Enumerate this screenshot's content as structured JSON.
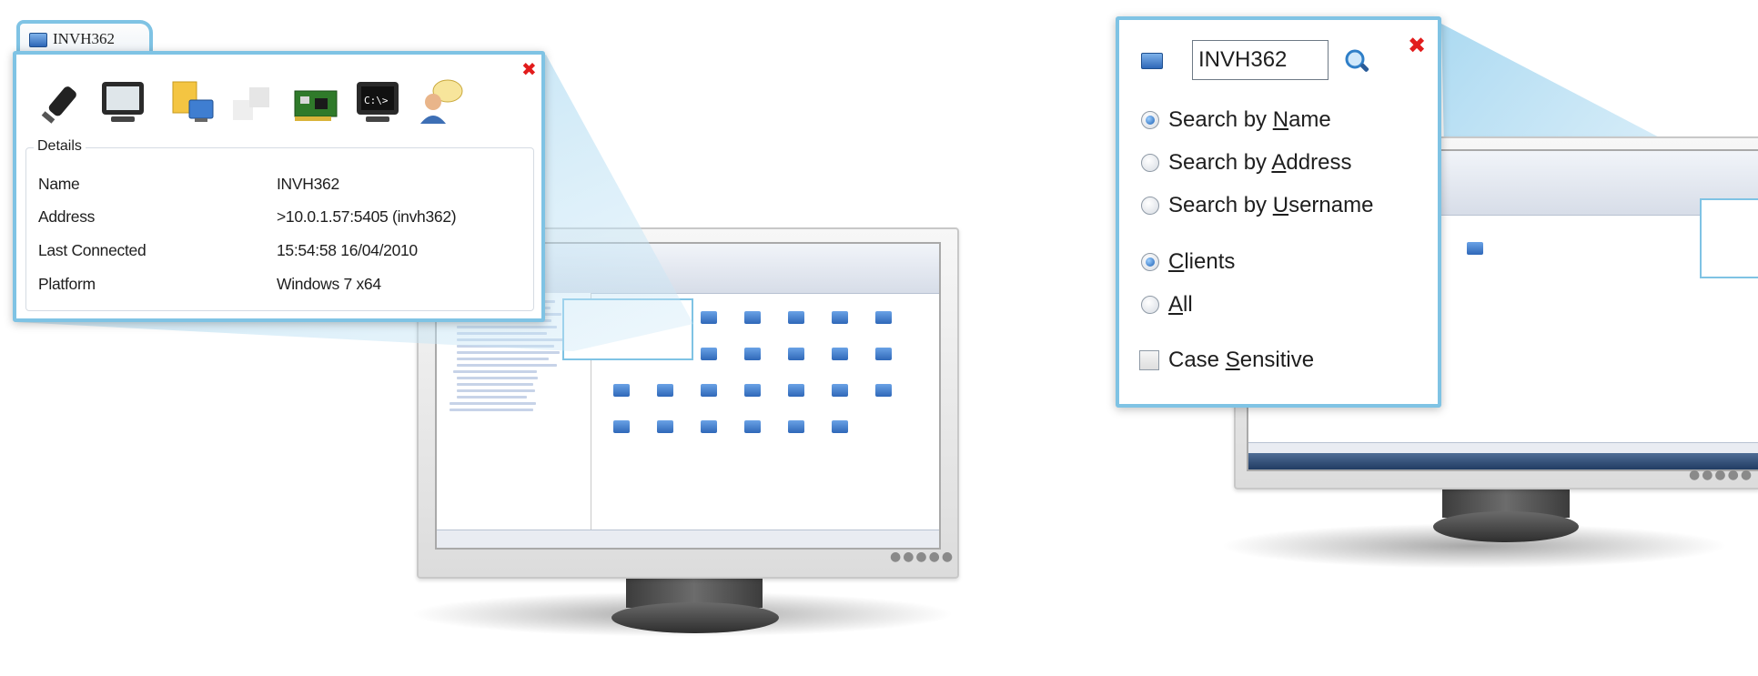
{
  "details_popup": {
    "tab_title": "INVH362",
    "group_title": "Details",
    "toolbar_icons": [
      "usb-plug-icon",
      "monitor-icon",
      "file-transfer-icon",
      "window-copy-icon",
      "network-card-icon",
      "command-prompt-icon",
      "chat-user-icon"
    ],
    "rows": [
      {
        "key": "Name",
        "value": "INVH362"
      },
      {
        "key": "Address",
        "value": ">10.0.1.57:5405 (invh362)"
      },
      {
        "key": "Last Connected",
        "value": "15:54:58 16/04/2010"
      },
      {
        "key": "Platform",
        "value": "Windows 7 x64"
      }
    ]
  },
  "search_popup": {
    "query": "INVH362",
    "search_by": [
      {
        "prefix": "Search by ",
        "accel": "N",
        "suffix": "ame",
        "selected": true
      },
      {
        "prefix": "Search by ",
        "accel": "A",
        "suffix": "ddress",
        "selected": false
      },
      {
        "prefix": "Search by ",
        "accel": "U",
        "suffix": "sername",
        "selected": false
      }
    ],
    "scope": [
      {
        "prefix": "",
        "accel": "C",
        "suffix": "lients",
        "selected": true
      },
      {
        "prefix": "",
        "accel": "A",
        "suffix": "ll",
        "selected": false
      }
    ],
    "case_sensitive": {
      "prefix": "Case ",
      "accel": "S",
      "suffix": "ensitive",
      "checked": false
    }
  },
  "colors": {
    "popup_border": "#7fc3e4",
    "close": "#e21c1c",
    "radio_selected": "#1a5fb4"
  }
}
